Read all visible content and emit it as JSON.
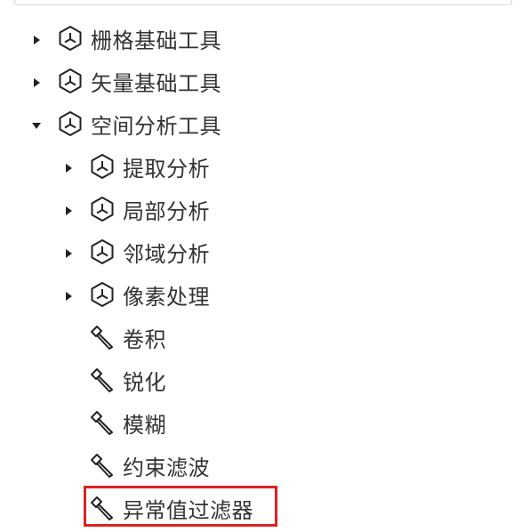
{
  "tree": {
    "items": [
      {
        "label": "栅格基础工具",
        "expanded": false,
        "kind": "toolbox",
        "icon": "cube-icon"
      },
      {
        "label": "矢量基础工具",
        "expanded": false,
        "kind": "toolbox",
        "icon": "cube-icon"
      },
      {
        "label": "空间分析工具",
        "expanded": true,
        "kind": "toolbox",
        "icon": "cube-icon"
      },
      {
        "label": "提取分析",
        "expanded": false,
        "kind": "toolbox",
        "icon": "cube-icon"
      },
      {
        "label": "局部分析",
        "expanded": false,
        "kind": "toolbox",
        "icon": "cube-icon"
      },
      {
        "label": "邻域分析",
        "expanded": false,
        "kind": "toolbox",
        "icon": "cube-icon"
      },
      {
        "label": "像素处理",
        "expanded": false,
        "kind": "toolbox",
        "icon": "cube-icon"
      },
      {
        "label": "卷积",
        "kind": "tool",
        "icon": "hammer-icon"
      },
      {
        "label": "锐化",
        "kind": "tool",
        "icon": "hammer-icon"
      },
      {
        "label": "模糊",
        "kind": "tool",
        "icon": "hammer-icon"
      },
      {
        "label": "约束滤波",
        "kind": "tool",
        "icon": "hammer-icon"
      },
      {
        "label": "异常值过滤器",
        "kind": "tool",
        "icon": "hammer-icon",
        "highlighted": true
      }
    ]
  },
  "colors": {
    "text": "#333333",
    "highlight": "#e02020",
    "border": "#d6d6d6"
  }
}
